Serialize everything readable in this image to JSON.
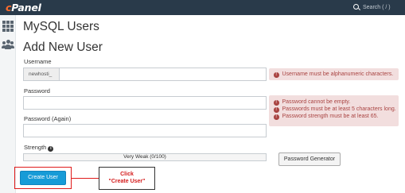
{
  "header": {
    "logo_text": "cPanel",
    "logo_initial": "c",
    "logo_rest": "Panel",
    "search_placeholder": "Search ( / )",
    "search_icon": "search-icon",
    "background_color": "#293a4a",
    "logo_accent_color": "#ff6c2c"
  },
  "sidebar": {
    "items": [
      {
        "icon": "grid-icon"
      },
      {
        "icon": "users-icon"
      }
    ]
  },
  "page": {
    "title": "MySQL Users",
    "section_title": "Add New User"
  },
  "form": {
    "username_label": "Username",
    "username_prefix": "newhosti_",
    "username_value": "",
    "password_label": "Password",
    "password_value": "",
    "password_again_label": "Password (Again)",
    "password_again_value": "",
    "strength_label": "Strength",
    "strength_value": "Very Weak (0/100)",
    "generator_button": "Password Generator",
    "create_button": "Create User",
    "create_button_color": "#179bd7"
  },
  "alerts": {
    "username_errors": [
      "Username must be alphanumeric characters."
    ],
    "password_errors": [
      "Password cannot be empty.",
      "Passwords must be at least 5 characters long.",
      "Password strength must be at least 65."
    ],
    "color_background": "#f2dede",
    "color_text": "#a94442"
  },
  "annotation": {
    "line1": "Click",
    "line2": "\"Create User\"",
    "color": "#e01b1b"
  }
}
